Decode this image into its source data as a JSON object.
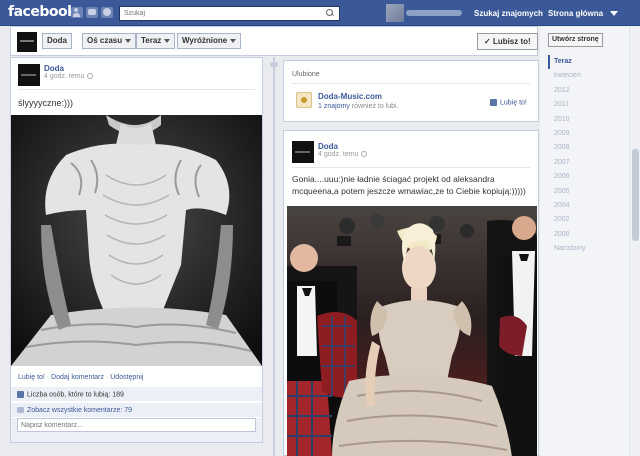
{
  "topbar": {
    "logo": "facebook",
    "search_placeholder": "Szukaj",
    "find_friends": "Szukaj znajomych",
    "home": "Strona główna"
  },
  "toolbar": {
    "page_name": "Doda",
    "timeline": "Oś czasu",
    "now": "Teraz",
    "highlights": "Wyróżnione",
    "like_button": "✓ Lubisz to!"
  },
  "post1": {
    "author": "Doda",
    "time": "4 godz. temu",
    "text": "ślyyyyczne:)))",
    "actions": [
      "Lubię to!",
      "Dodaj komentarz",
      "Udostępnij"
    ],
    "likes": "Liczba osób, które to lubią: 189",
    "comments": "Zobacz wszystkie komentarze: 79",
    "comment_placeholder": "Napisz komentarz..."
  },
  "favorites": {
    "title": "Ulubione",
    "name": "Doda-Music.com",
    "meta_friend": "1 znajomy",
    "meta_rest": " również to lubi.",
    "like": "Lubię to!"
  },
  "post2": {
    "author": "Doda",
    "time": "4 godz. temu",
    "text": "Gonia....uuu:)nie ładnie ściagać projekt od aleksandra mcqueena,a potem jeszcze wmawiac,ze to Ciebie kopiują:)))))"
  },
  "sidebar": {
    "create_page": "Utwórz stronę",
    "years": [
      "Teraz",
      "kwiecień",
      "2012",
      "2011",
      "2010",
      "2009",
      "2008",
      "2007",
      "2006",
      "2005",
      "2004",
      "2002",
      "2000",
      "Narodziny"
    ],
    "active_year": "Teraz"
  },
  "colors": {
    "brand": "#3b5998",
    "background": "#e9ebee"
  }
}
